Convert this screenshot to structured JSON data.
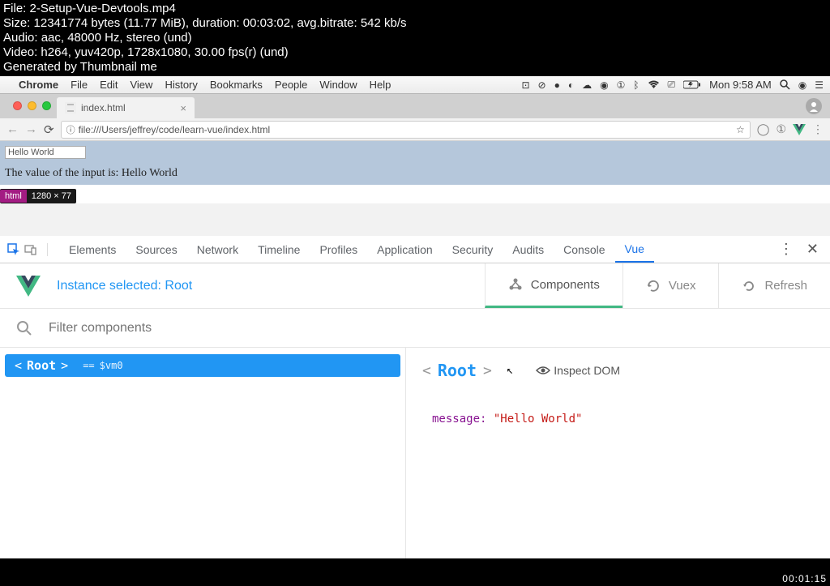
{
  "overlay": {
    "line1": "File: 2-Setup-Vue-Devtools.mp4",
    "line2": "Size: 12341774 bytes (11.77 MiB), duration: 00:03:02, avg.bitrate: 542 kb/s",
    "line3": "Audio: aac, 48000 Hz, stereo (und)",
    "line4": "Video: h264, yuv420p, 1728x1080, 30.00 fps(r) (und)",
    "line5": "Generated by Thumbnail me"
  },
  "menubar": {
    "app": "Chrome",
    "items": [
      "File",
      "Edit",
      "View",
      "History",
      "Bookmarks",
      "People",
      "Window",
      "Help"
    ],
    "clock": "Mon 9:58 AM"
  },
  "chrome": {
    "tab_title": "index.html",
    "url": "file:///Users/jeffrey/code/learn-vue/index.html"
  },
  "page": {
    "input_value": "Hello World",
    "text": "The value of the input is: Hello World",
    "badge_tag": "html",
    "badge_dims": "1280 × 77"
  },
  "devtools": {
    "tabs": [
      "Elements",
      "Sources",
      "Network",
      "Timeline",
      "Profiles",
      "Application",
      "Security",
      "Audits",
      "Console",
      "Vue"
    ],
    "active_tab": "Vue"
  },
  "vue": {
    "instance_label": "Instance selected: Root",
    "panel_tabs": {
      "components": "Components",
      "vuex": "Vuex",
      "refresh": "Refresh"
    },
    "filter_placeholder": "Filter components",
    "tree": {
      "node_open": "<",
      "node_name": "Root",
      "node_close": ">",
      "vm_eq": "==",
      "vm_ref": "$vm0"
    },
    "inspector": {
      "bracket_open": "<",
      "name": "Root",
      "bracket_close": ">",
      "inspect_label": "Inspect DOM",
      "prop_key": "message:",
      "prop_val": "\"Hello World\""
    }
  },
  "timestamp": "00:01:15"
}
